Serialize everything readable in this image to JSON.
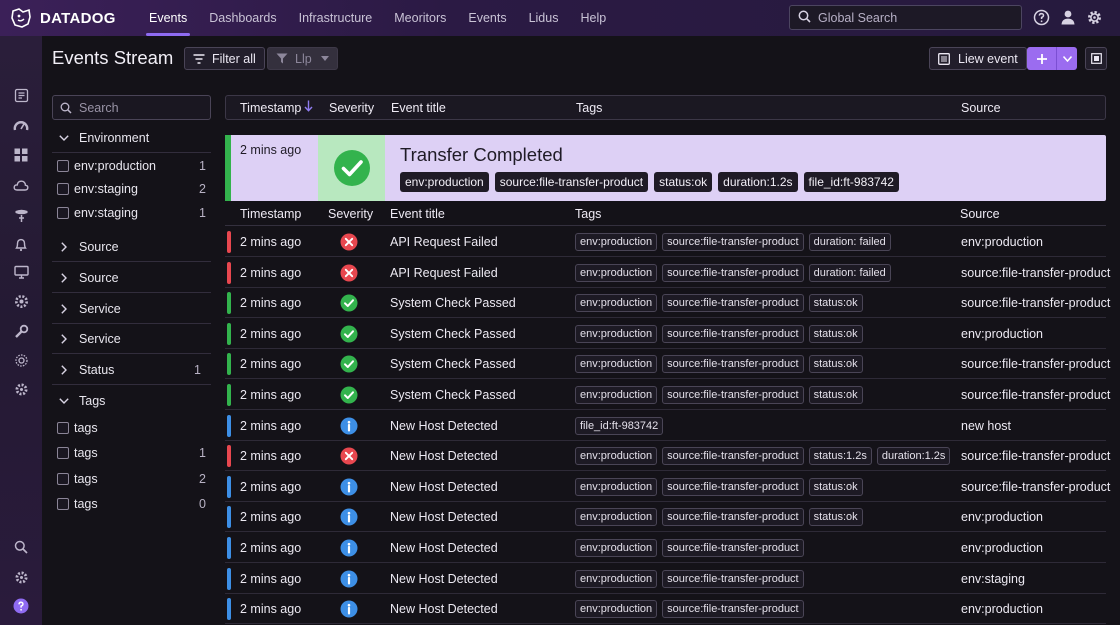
{
  "brand": "DATADOG",
  "nav": [
    "Events",
    "Dashboards",
    "Infrastructure",
    "Meoritors",
    "Events",
    "Lidus",
    "Help"
  ],
  "global_search_placeholder": "Global Search",
  "page_title": "Events Stream",
  "toolbar": {
    "filter_all": "Filter all",
    "llp": "Llp",
    "view_event": "Liew event"
  },
  "facets": {
    "search_placeholder": "Search",
    "environment": {
      "label": "Environment",
      "options": [
        {
          "label": "env:production",
          "count": "1"
        },
        {
          "label": "env:staging",
          "count": "2"
        },
        {
          "label": "env:staging",
          "count": "1"
        }
      ]
    },
    "groups": [
      {
        "label": "Source",
        "count": ""
      },
      {
        "label": "Source",
        "count": ""
      },
      {
        "label": "Service",
        "count": ""
      },
      {
        "label": "Service",
        "count": ""
      },
      {
        "label": "Status",
        "count": "1"
      }
    ],
    "tags": {
      "label": "Tags",
      "options": [
        {
          "label": "tags",
          "count": ""
        },
        {
          "label": "tags",
          "count": "1"
        },
        {
          "label": "tags",
          "count": "2"
        },
        {
          "label": "tags",
          "count": "0"
        }
      ]
    }
  },
  "columns": {
    "timestamp": "Timestamp",
    "severity": "Severity",
    "event_title": "Event title",
    "tags": "Tags",
    "source": "Source"
  },
  "featured": {
    "time": "2 mins ago",
    "severity": "success",
    "title": "Transfer Completed",
    "tags": [
      "env:production",
      "source:file-transfer-product",
      "status:ok",
      "duration:1.2s",
      "file_id:ft-983742"
    ]
  },
  "rows": [
    {
      "time": "2 mins ago",
      "severity": "error",
      "title": "API Request Failed",
      "tags": [
        "env:production",
        "source:file-transfer-product",
        "duration: failed"
      ],
      "source": "env:production"
    },
    {
      "time": "2 mins ago",
      "severity": "error",
      "title": "API Request Failed",
      "tags": [
        "env:production",
        "source:file-transfer-product",
        "duration: failed"
      ],
      "source": "source:file-transfer-product"
    },
    {
      "time": "2 mins ago",
      "severity": "success",
      "title": "System Check Passed",
      "tags": [
        "env:production",
        "source:file-transfer-product",
        "status:ok"
      ],
      "source": "source:file-transfer-product"
    },
    {
      "time": "2 mins ago",
      "severity": "success",
      "title": "System Check Passed",
      "tags": [
        "env:production",
        "source:file-transfer-product",
        "status:ok"
      ],
      "source": "env:production"
    },
    {
      "time": "2 mins ago",
      "severity": "success",
      "title": "System Check Passed",
      "tags": [
        "env:production",
        "source:file-transfer-product",
        "status:ok"
      ],
      "source": "source:file-transfer-product"
    },
    {
      "time": "2 mins ago",
      "severity": "success",
      "title": "System Check Passed",
      "tags": [
        "env:production",
        "source:file-transfer-product",
        "status:ok"
      ],
      "source": "source:file-transfer-product"
    },
    {
      "time": "2 mins ago",
      "severity": "info",
      "title": "New Host Detected",
      "tags": [
        "file_id:ft-983742"
      ],
      "source": "new host"
    },
    {
      "time": "2 mins ago",
      "severity": "error",
      "title": "New Host Detected",
      "tags": [
        "env:production",
        "source:file-transfer-product",
        "status:1.2s",
        "duration:1.2s"
      ],
      "source": "source:file-transfer-product"
    },
    {
      "time": "2 mins ago",
      "severity": "info",
      "title": "New Host Detected",
      "tags": [
        "env:production",
        "source:file-transfer-product",
        "status:ok"
      ],
      "source": "source:file-transfer-product"
    },
    {
      "time": "2 mins ago",
      "severity": "info",
      "title": "New Host Detected",
      "tags": [
        "env:production",
        "source:file-transfer-product",
        "status:ok"
      ],
      "source": "env:production"
    },
    {
      "time": "2 mins ago",
      "severity": "info",
      "title": "New Host Detected",
      "tags": [
        "env:production",
        "source:file-transfer-product"
      ],
      "source": "env:production"
    },
    {
      "time": "2 mins ago",
      "severity": "info",
      "title": "New Host Detected",
      "tags": [
        "env:production",
        "source:file-transfer-product"
      ],
      "source": "env:staging"
    },
    {
      "time": "2 mins ago",
      "severity": "info",
      "title": "New Host Detected",
      "tags": [
        "env:production",
        "source:file-transfer-product"
      ],
      "source": "env:production"
    }
  ],
  "colors": {
    "success": "#33b34d",
    "error": "#e8474f",
    "info": "#3d8fe6",
    "accent": "#9b6cf0"
  }
}
